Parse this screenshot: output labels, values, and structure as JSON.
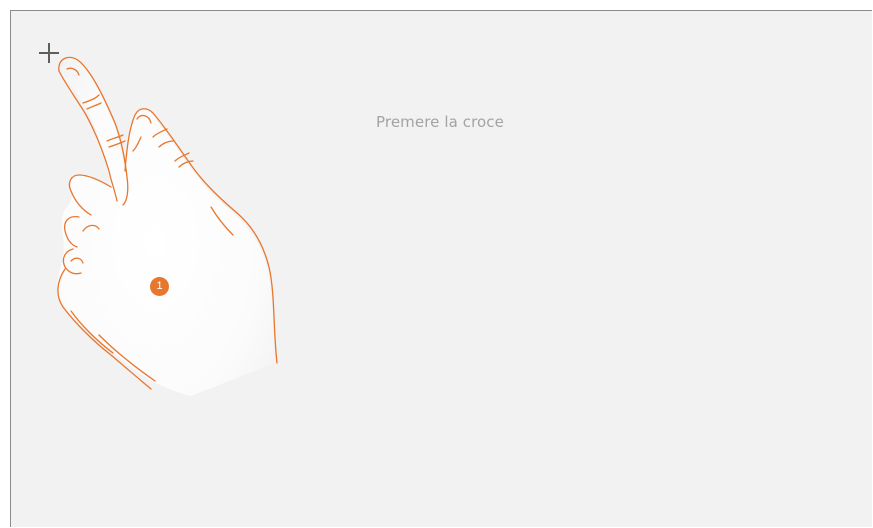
{
  "instruction_text": "Premere la croce",
  "step_badge": "1",
  "icons": {
    "target": "calibration-cross-icon",
    "hand": "pointing-hand-icon"
  },
  "colors": {
    "screen_background": "#f2f2f2",
    "hand_outline": "#e8772e",
    "badge": "#e8772e",
    "instruction_text": "#a3a3a3",
    "cross": "#5e5e5e"
  }
}
